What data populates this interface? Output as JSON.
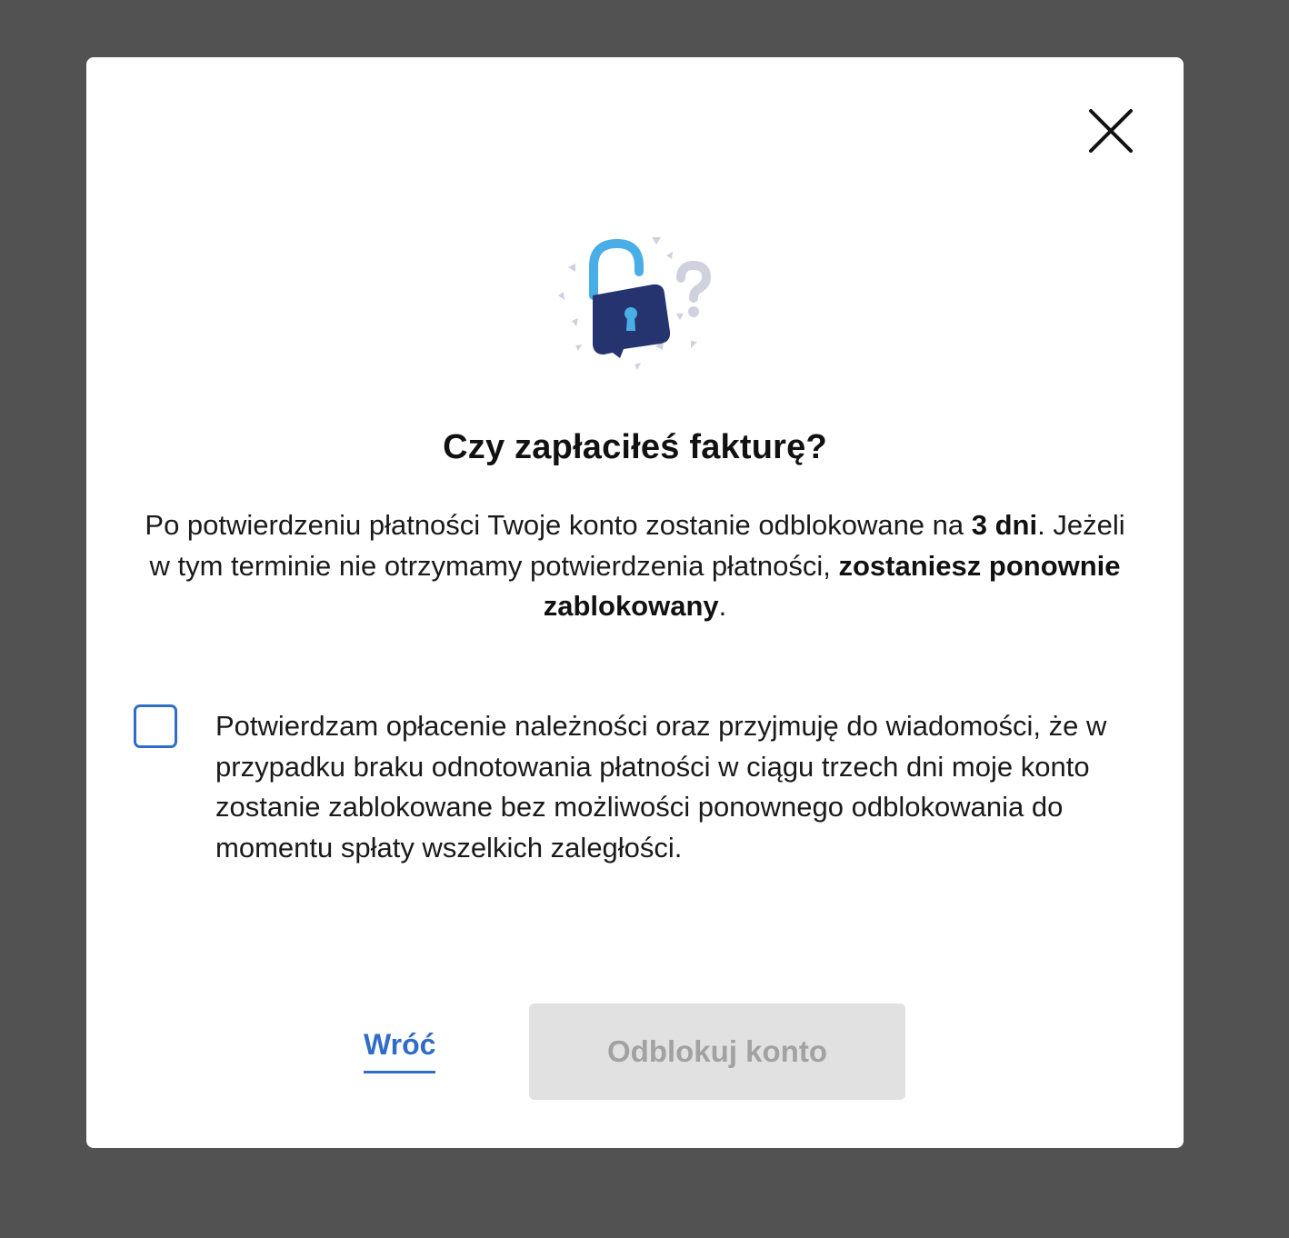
{
  "dialog": {
    "title": "Czy zapłaciłeś fakturę?",
    "description": {
      "part1": "Po potwierdzeniu płatności Twoje konto zostanie odblokowane na ",
      "bold1": "3 dni",
      "part2": ". Jeżeli w tym terminie nie otrzymamy potwierdzenia płatności, ",
      "bold2": "zostaniesz ponownie zablokowany",
      "part3": "."
    },
    "consent": {
      "checked": false,
      "label": "Potwierdzam opłacenie należności oraz przyjmuję do wiadomości, że w przypadku braku odnotowania płatności w ciągu trzech dni moje konto zostanie zablokowane bez możliwości ponownego odblokowania do momentu spłaty wszelkich zaległości."
    },
    "actions": {
      "back_label": "Wróć",
      "unlock_label": "Odblokuj konto",
      "unlock_enabled": false
    },
    "icons": {
      "close": "close-icon",
      "illustration": "unlocked-padlock-question-icon"
    }
  },
  "colors": {
    "backdrop": "#525252",
    "accent": "#2f6dc8",
    "lock_body": "#25336e",
    "lock_shackle": "#4aaee6",
    "question_mark": "#cfd1df",
    "disabled_button_bg": "#e1e1e1",
    "disabled_button_text": "#a2a2a2"
  }
}
